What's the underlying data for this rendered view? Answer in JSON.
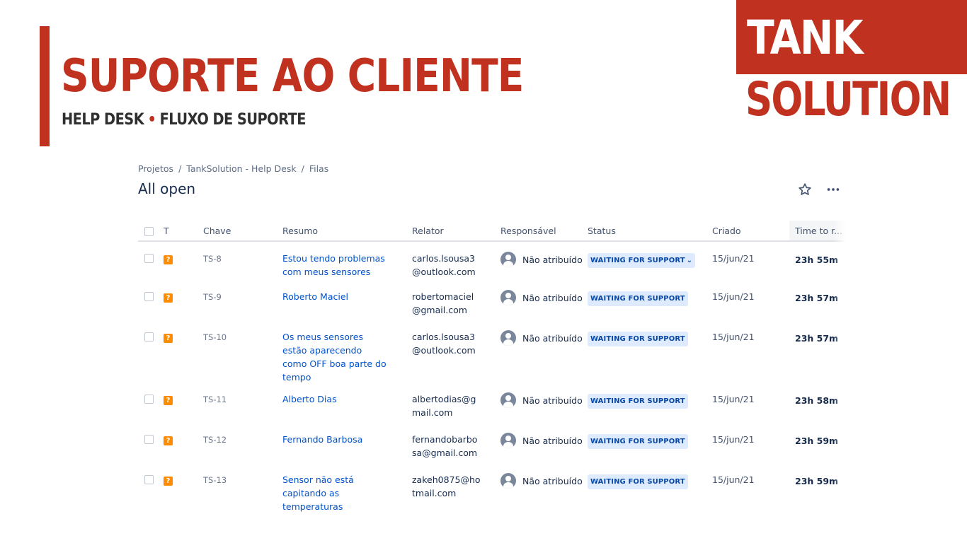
{
  "slide": {
    "title": "SUPORTE AO CLIENTE",
    "subtitle_left": "HELP DESK",
    "subtitle_dot": "•",
    "subtitle_right": "FLUXO DE SUPORTE",
    "brand_top": "TANK",
    "brand_bottom": "SOLUTION",
    "accent_color": "#c0321f"
  },
  "breadcrumb": {
    "items": [
      "Projetos",
      "TankSolution - Help Desk",
      "Filas"
    ],
    "separator": "/"
  },
  "queue": {
    "title": "All open",
    "actions": {
      "star_icon": "star-icon",
      "more_icon": "more-horizontal-icon"
    },
    "columns": [
      "T",
      "Chave",
      "Resumo",
      "Relator",
      "Responsável",
      "Status",
      "Criado",
      "Time to r..."
    ],
    "rows": [
      {
        "type_icon": "?",
        "key": "TS-8",
        "summary": "Estou tendo problemas com meus sensores",
        "reporter": "carlos.lsousa3@outlook.com",
        "assignee": "Não atribuído",
        "status": "WAITING FOR SUPPORT",
        "status_dropdown": "⌄",
        "created": "15/jun/21",
        "time": "23h 55m"
      },
      {
        "type_icon": "?",
        "key": "TS-9",
        "summary": "Roberto Maciel",
        "reporter": "robertomaciel@gmail.com",
        "assignee": "Não atribuído",
        "status": "WAITING FOR SUPPORT",
        "created": "15/jun/21",
        "time": "23h 57m"
      },
      {
        "type_icon": "?",
        "key": "TS-10",
        "summary": "Os meus sensores estão aparecendo como OFF boa parte do tempo",
        "reporter": "carlos.lsousa3@outlook.com",
        "assignee": "Não atribuído",
        "status": "WAITING FOR SUPPORT",
        "created": "15/jun/21",
        "time": "23h 57m"
      },
      {
        "type_icon": "?",
        "key": "TS-11",
        "summary": "Alberto Dias",
        "reporter": "albertodias@gmail.com",
        "assignee": "Não atribuído",
        "status": "WAITING FOR SUPPORT",
        "created": "15/jun/21",
        "time": "23h 58m"
      },
      {
        "type_icon": "?",
        "key": "TS-12",
        "summary": "Fernando Barbosa",
        "reporter": "fernandobarbosa@gmail.com",
        "assignee": "Não atribuído",
        "status": "WAITING FOR SUPPORT",
        "created": "15/jun/21",
        "time": "23h 59m"
      },
      {
        "type_icon": "?",
        "key": "TS-13",
        "summary": "Sensor não está capitando as temperaturas",
        "reporter": "zakeh0875@hotmail.com",
        "assignee": "Não atribuído",
        "status": "WAITING FOR SUPPORT",
        "created": "15/jun/21",
        "time": "23h 59m"
      }
    ]
  }
}
